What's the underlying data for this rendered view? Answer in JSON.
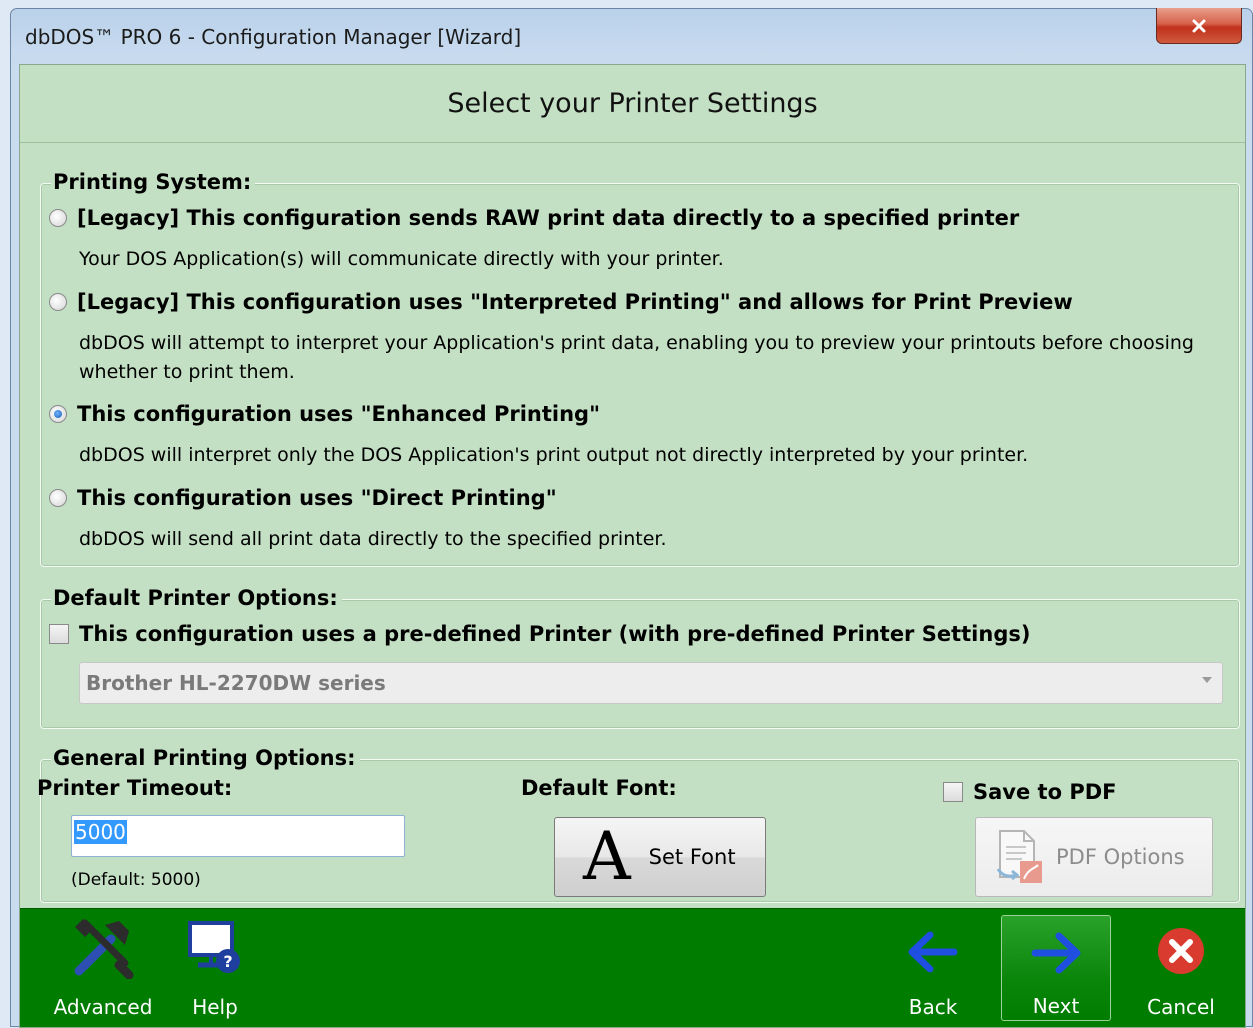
{
  "window": {
    "title": "dbDOS™ PRO 6 - Configuration Manager [Wizard]"
  },
  "header": {
    "title": "Select your Printer Settings"
  },
  "printing_system": {
    "title": "Printing System:",
    "options": [
      {
        "label": "[Legacy] This configuration sends RAW print data directly to a specified printer",
        "desc": "Your DOS Application(s) will communicate directly with your printer.",
        "checked": false
      },
      {
        "label": "[Legacy] This configuration uses \"Interpreted Printing\" and allows for Print Preview",
        "desc": "dbDOS will attempt to interpret your Application's print data, enabling you to preview your printouts before choosing whether to print them.",
        "checked": false
      },
      {
        "label": "This configuration uses \"Enhanced Printing\"",
        "desc": "dbDOS will interpret only the DOS Application's print output not directly interpreted by your printer.",
        "checked": true
      },
      {
        "label": "This configuration uses \"Direct Printing\"",
        "desc": "dbDOS will send all print data directly to the specified printer.",
        "checked": false
      }
    ]
  },
  "default_printer": {
    "title": "Default Printer Options:",
    "checkbox_label": "This configuration uses a pre-defined Printer (with pre-defined Printer Settings)",
    "checked": false,
    "selected_printer": "Brother HL-2270DW series"
  },
  "general": {
    "title": "General Printing Options:",
    "timeout_label": "Printer Timeout:",
    "timeout_value": "5000",
    "timeout_default": "(Default: 5000)",
    "font_label": "Default Font:",
    "set_font_button": "Set Font",
    "font_glyph": "A",
    "save_pdf_label": "Save to PDF",
    "save_pdf_checked": false,
    "pdf_options_button": "PDF Options"
  },
  "footer": {
    "advanced": "Advanced",
    "help": "Help",
    "back": "Back",
    "next": "Next",
    "cancel": "Cancel"
  },
  "colors": {
    "client_bg": "#c4e0c4",
    "footer_bg": "#007d00",
    "close_red": "#c0311b",
    "arrow_blue": "#1f4fe0"
  }
}
